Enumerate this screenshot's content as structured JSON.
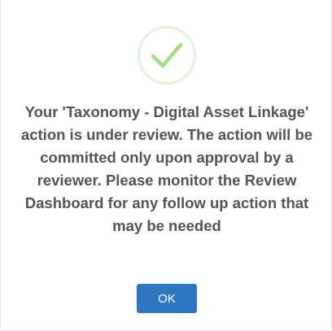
{
  "dialog": {
    "icon": "success-check-icon",
    "message": "Your 'Taxonomy - Digital Asset Linkage' action is under review. The action will be committed only upon approval by a reviewer. Please monitor the Review Dashboard for any follow up action that may be needed",
    "ok_label": "OK"
  },
  "colors": {
    "icon_ring": "#e4f2d8",
    "check": "#a5dc86",
    "message_text": "#545454",
    "button_bg": "#2f77c0",
    "button_text": "#ffffff"
  }
}
